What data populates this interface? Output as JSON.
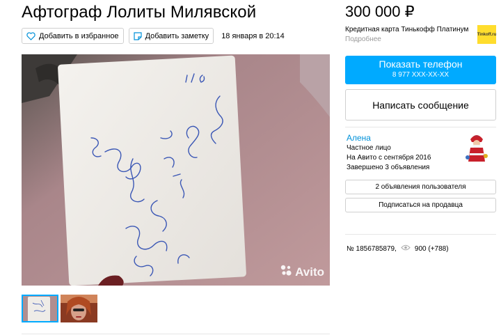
{
  "listing": {
    "title": "Афтограф Лолиты Милявской",
    "favorite_label": "Добавить в избранное",
    "note_label": "Добавить заметку",
    "date": "18 января в 20:14",
    "watermark": "Avito"
  },
  "sidebar": {
    "price": "300 000 ₽",
    "credit_text": "Кредитная карта Тинькофф Платинум",
    "credit_more": "Подробнее",
    "bank_logo_text": "Tinkoff.ru",
    "phone_button": {
      "label": "Показать телефон",
      "number": "8 977 XXX-XX-XX"
    },
    "message_button": "Написать сообщение",
    "seller": {
      "name": "Алена",
      "type": "Частное лицо",
      "since": "На Авито с сентября 2016",
      "completed": "Завершено 3 объявления"
    },
    "user_ads_button": "2 объявления пользователя",
    "subscribe_button": "Подписаться на продавца",
    "ad_number": "№ 1856785879,",
    "views": "900 (+788)"
  },
  "colors": {
    "accent": "#00aaff",
    "link": "#0091d9",
    "bank": "#ffdd2d"
  },
  "icons": [
    "heart-icon",
    "note-icon",
    "eye-icon",
    "camera-icon"
  ]
}
